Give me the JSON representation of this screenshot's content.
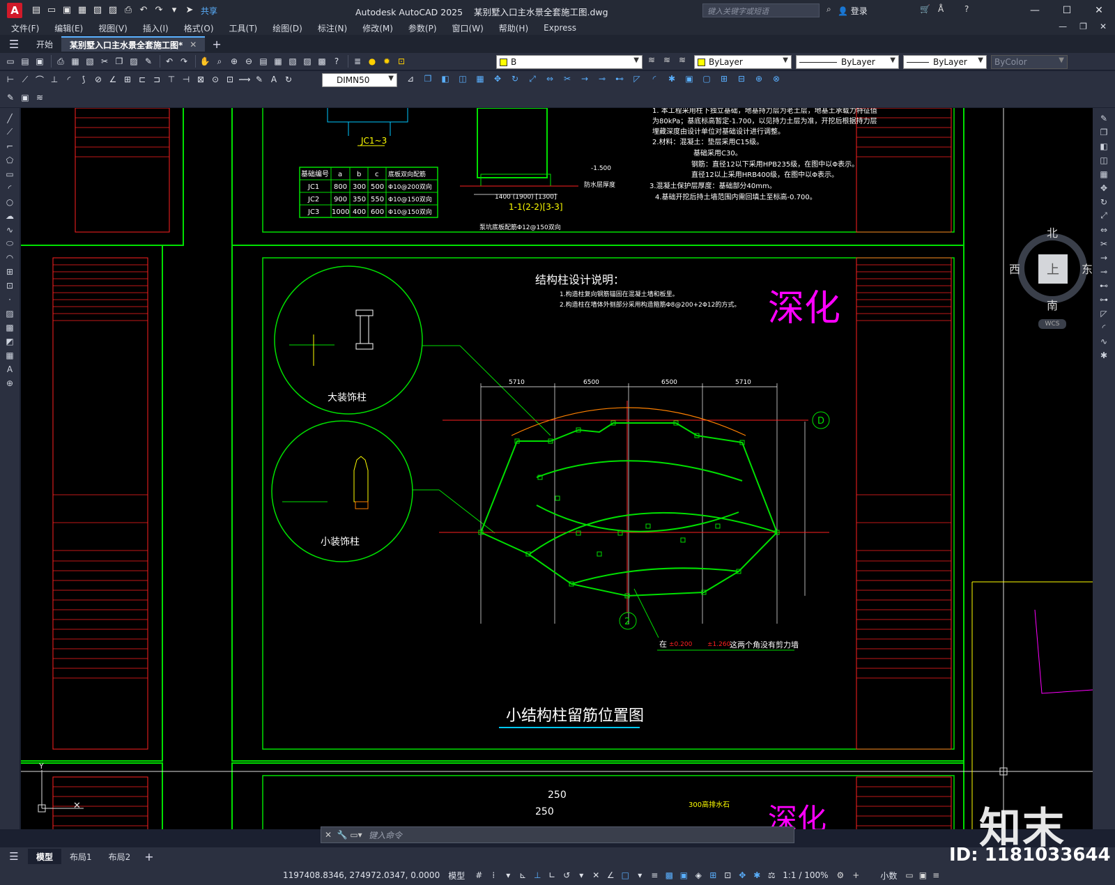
{
  "app": {
    "title": "Autodesk AutoCAD 2025",
    "document": "某别墅入口主水景全套施工图.dwg",
    "search_placeholder": "键入关键字或短语",
    "login": "登录",
    "share": "共享"
  },
  "menu": [
    "文件(F)",
    "编辑(E)",
    "视图(V)",
    "插入(I)",
    "格式(O)",
    "工具(T)",
    "绘图(D)",
    "标注(N)",
    "修改(M)",
    "参数(P)",
    "窗口(W)",
    "帮助(H)",
    "Express"
  ],
  "tabs": {
    "start": "开始",
    "active": "某别墅入口主水景全套施工图*"
  },
  "toolbar": {
    "layer": "B",
    "color": "ByLayer",
    "linetype": "ByLayer",
    "lineweight": "ByLayer",
    "plotstyle": "ByColor",
    "dimstyle": "DIMN50"
  },
  "viewcube": {
    "north": "北",
    "south": "南",
    "east": "东",
    "west": "西",
    "top": "上",
    "wcs": "WCS"
  },
  "drawing": {
    "jc_title": "JC1~3",
    "table_headers": [
      "基础编号",
      "a",
      "b",
      "c",
      "底板双向配筋"
    ],
    "table_rows": [
      [
        "JC1",
        "800",
        "300",
        "500",
        "Φ10@200双向"
      ],
      [
        "JC2",
        "900",
        "350",
        "550",
        "Φ10@150双向"
      ],
      [
        "JC3",
        "1000",
        "400",
        "600",
        "Φ10@150双向"
      ]
    ],
    "section_label": "1-1(2-2)[3-3]",
    "bottom_rebar": "泵坑底板配筋Φ12@150双向",
    "notes": [
      "1. 本工程采用柱下独立基础，地基持力层为老土层，地基土承载力特征值",
      "为80kPa；基底标高暂定-1.700，以见持力土层为准，开挖后根据持力层",
      "埋藏深度由设计单位对基础设计进行调整。",
      "2.材料：混凝土：垫层采用C15级。",
      "基础采用C30。",
      "钢筋：直径12以下采用HPB235级，在图中以Φ表示。",
      "直径12以上采用HRB400级，在图中以Φ表示。",
      "3.混凝土保护层厚度：基础部分40mm。",
      "4.基础开挖后持土墙范围内需回填土至标高-0.700。"
    ],
    "col_title": "结构柱设计说明：",
    "col_notes": [
      "1.构造柱复向钢筋锚固在混凝土墙和板里。",
      "2.构造柱在墙体外侧部分采用构造箍筋Φ8@200+2Φ12的方式。"
    ],
    "shenhua": "深化",
    "big_col": "大装饰柱",
    "small_col": "小装饰柱",
    "plan_title": "小结构柱留筋位置图",
    "dims_top": [
      "5710",
      "6500",
      "6500",
      "5710"
    ],
    "axis_d": "D",
    "axis_2": "2",
    "note_corner": "这两个角没有剪力墙",
    "level1": "±0.200",
    "level2": "±1.260",
    "bottom_dim1": "250",
    "bottom_dim2": "250",
    "bottom_note": "300高排水石",
    "elev": "-1.500",
    "waterproof": "防水层厚度"
  },
  "command": {
    "placeholder": "键入命令"
  },
  "layouts": [
    "模型",
    "布局1",
    "布局2"
  ],
  "status": {
    "coords": "1197408.8346, 274972.0347, 0.0000",
    "space": "模型",
    "scale": "1:1 / 100%",
    "units": "小数"
  },
  "watermark": {
    "logo": "知末",
    "id": "ID: 1181033644"
  },
  "colors": {
    "green": "#00e000",
    "red": "#ff2020",
    "magenta": "#ff00ff",
    "yellow": "#ffff00",
    "cyan": "#00c8ff",
    "white": "#ffffff"
  }
}
